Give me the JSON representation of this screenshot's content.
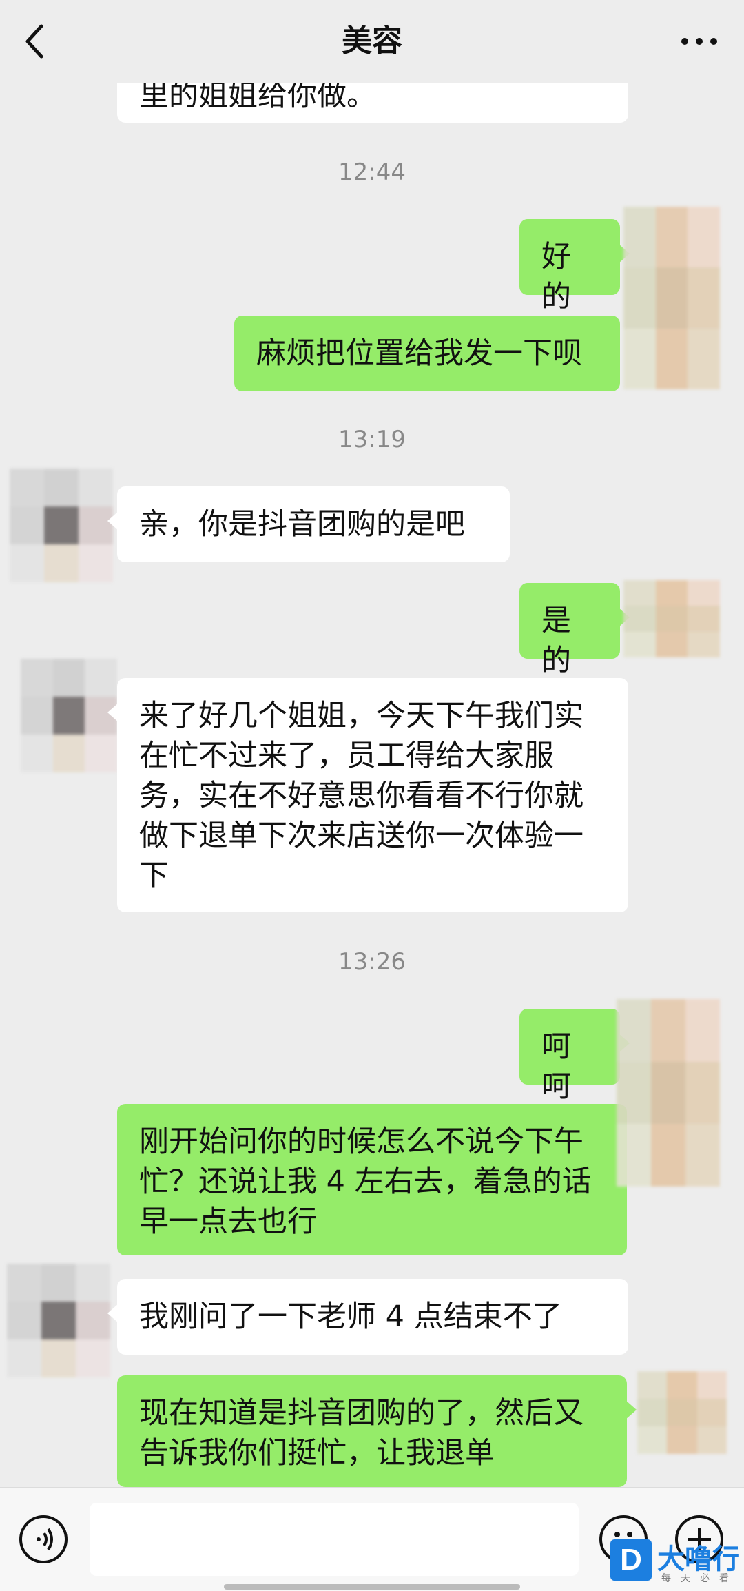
{
  "header": {
    "title": "美容",
    "back_icon": "chevron-left-icon",
    "more_icon": "more-dots-icon"
  },
  "messages": [
    {
      "type": "in",
      "text": "里的姐姐给你做。"
    },
    {
      "type": "time",
      "text": "12:44"
    },
    {
      "type": "out",
      "text": "好的"
    },
    {
      "type": "out",
      "text": "麻烦把位置给我发一下呗"
    },
    {
      "type": "time",
      "text": "13:19"
    },
    {
      "type": "in",
      "text": "亲，你是抖音团购的是吧"
    },
    {
      "type": "out",
      "text": "是的"
    },
    {
      "type": "in",
      "text": "来了好几个姐姐，今天下午我们实在忙不过来了，员工得给大家服务，实在不好意思你看看不行你就做下退单下次来店送你一次体验一下"
    },
    {
      "type": "time",
      "text": "13:26"
    },
    {
      "type": "out",
      "text": "呵呵"
    },
    {
      "type": "out",
      "text": "刚开始问你的时候怎么不说今下午忙？还说让我 4 左右去，着急的话早一点去也行"
    },
    {
      "type": "in",
      "text": "我刚问了一下老师 4 点结束不了"
    },
    {
      "type": "out",
      "text": "现在知道是抖音团购的了，然后又告诉我你们挺忙，让我退单"
    }
  ],
  "bottom": {
    "voice_icon": "voice-icon",
    "emoji_icon": "emoji-icon",
    "plus_icon": "plus-icon"
  },
  "watermark": {
    "logo": "D",
    "text": "大噜行",
    "sub": "每天必看"
  },
  "colors": {
    "outgoing": "#95ec69",
    "incoming": "#ffffff",
    "background": "#ededed"
  }
}
